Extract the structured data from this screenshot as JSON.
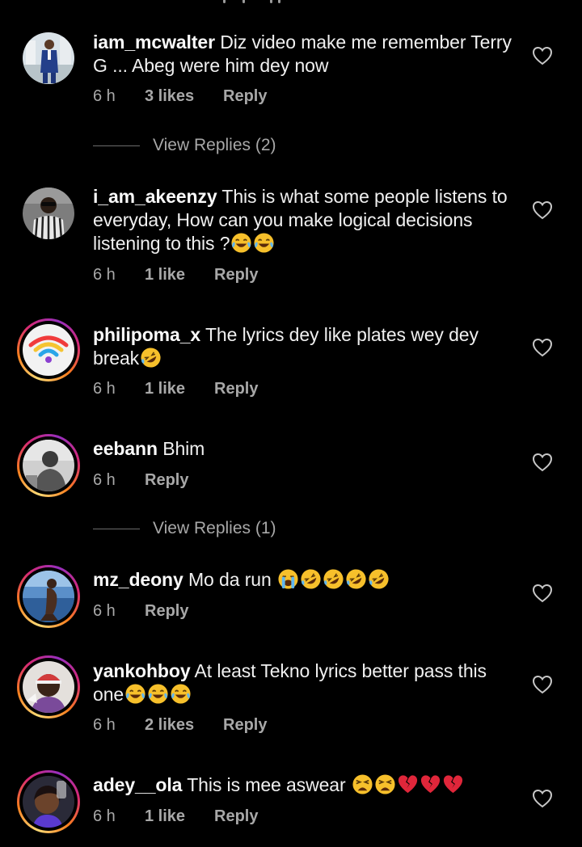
{
  "comments": [
    {
      "username": "iam_mcwalter",
      "text": "Diz video make me remember Terry G ... Abeg were him dey now",
      "time": "6 h",
      "likes": "3 likes",
      "reply": "Reply",
      "emojis": [],
      "view_replies": "View Replies (2)",
      "avatar": "man-in-suit-photo",
      "story_ring": false
    },
    {
      "username": "i_am_akeenzy",
      "text": "This is what some people listens to everyday, How can you make logical decisions listening to this ?",
      "time": "6 h",
      "likes": "1 like",
      "reply": "Reply",
      "emojis": [
        "tears-of-joy",
        "tears-of-joy"
      ],
      "avatar": "man-with-sunglasses-photo",
      "story_ring": false
    },
    {
      "username": "philipoma_x",
      "text": "The lyrics dey like plates wey dey break",
      "time": "6 h",
      "likes": "1 like",
      "reply": "Reply",
      "emojis": [
        "rolling-laughing"
      ],
      "avatar": "rainbow-wifi-logo",
      "story_ring": true
    },
    {
      "username": "eebann",
      "text": "Bhim",
      "time": "6 h",
      "likes": "",
      "reply": "Reply",
      "emojis": [],
      "view_replies": "View Replies (1)",
      "avatar": "grayscale-portrait-photo",
      "story_ring": true
    },
    {
      "username": "mz_deony",
      "text": "Mo da run",
      "time": "6 h",
      "likes": "",
      "reply": "Reply",
      "emojis": [
        "loudly-crying",
        "rolling-laughing",
        "rolling-laughing",
        "rolling-laughing",
        "rolling-laughing"
      ],
      "avatar": "person-on-beach-photo",
      "story_ring": true
    },
    {
      "username": "yankohboy",
      "text": "At least Tekno lyrics better pass this one",
      "time": "6 h",
      "likes": "2 likes",
      "reply": "Reply",
      "emojis": [
        "tears-of-joy",
        "tears-of-joy",
        "tears-of-joy"
      ],
      "avatar": "man-with-cap-photo",
      "story_ring": true
    },
    {
      "username": "adey__ola",
      "text": "This is mee aswear",
      "time": "6 h",
      "likes": "1 like",
      "reply": "Reply",
      "emojis": [
        "tired-face",
        "tired-face",
        "broken-heart",
        "broken-heart",
        "broken-heart"
      ],
      "avatar": "woman-selfie-photo",
      "story_ring": true
    }
  ],
  "icons": {
    "like": "heart-outline-icon"
  },
  "colors": {
    "background": "#000000",
    "primary_text": "#f5f5f5",
    "secondary_text": "#a8a8a8",
    "divider": "#6c6c6c"
  }
}
